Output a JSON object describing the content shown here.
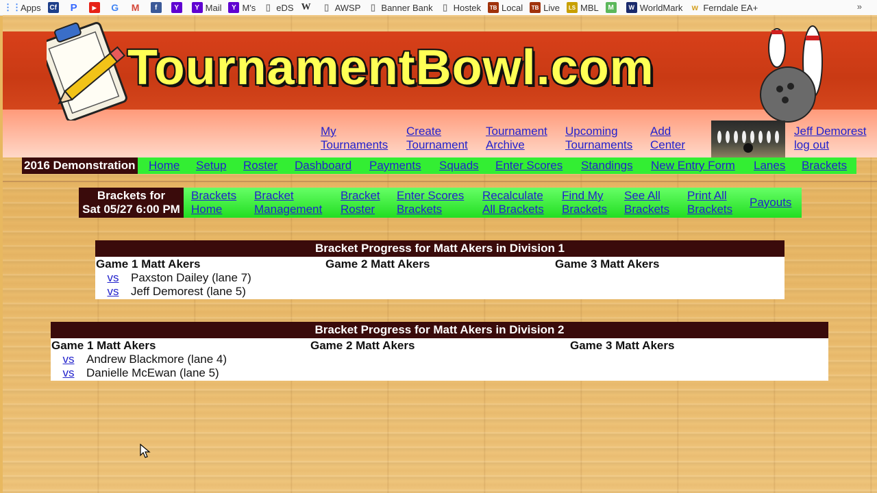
{
  "bookmarks": [
    {
      "label": "Apps",
      "icon": "apps-grid-icon",
      "color": "#4285f4"
    },
    {
      "label": "",
      "icon": "cf-icon",
      "color": "#1e3f8a",
      "glyph": "Cf"
    },
    {
      "label": "",
      "icon": "pandora-icon",
      "color": "#3668ff",
      "glyph": "P"
    },
    {
      "label": "",
      "icon": "youtube-icon",
      "color": "#e62117",
      "glyph": "▶"
    },
    {
      "label": "",
      "icon": "google-icon",
      "color": "#4285f4",
      "glyph": "G"
    },
    {
      "label": "",
      "icon": "gmail-icon",
      "color": "#d44638",
      "glyph": "M"
    },
    {
      "label": "",
      "icon": "facebook-icon",
      "color": "#3b5998",
      "glyph": "f"
    },
    {
      "label": "",
      "icon": "yahoo-icon",
      "color": "#5f01d1",
      "glyph": "Y"
    },
    {
      "label": "Mail",
      "icon": "yahoo-mail-icon",
      "color": "#5f01d1",
      "glyph": "Y"
    },
    {
      "label": "M's",
      "icon": "yahoo-ms-icon",
      "color": "#5f01d1",
      "glyph": "Y"
    },
    {
      "label": "eDS",
      "icon": "page-icon",
      "color": "#888888",
      "glyph": "▯"
    },
    {
      "label": "",
      "icon": "wikipedia-icon",
      "color": "#333333",
      "glyph": "W"
    },
    {
      "label": "AWSP",
      "icon": "page-icon",
      "color": "#888888",
      "glyph": "▯"
    },
    {
      "label": "Banner Bank",
      "icon": "page-icon",
      "color": "#888888",
      "glyph": "▯"
    },
    {
      "label": "Hostek",
      "icon": "page-icon",
      "color": "#888888",
      "glyph": "▯"
    },
    {
      "label": "Local",
      "icon": "tb-icon",
      "color": "#a0320c",
      "glyph": "TB"
    },
    {
      "label": "Live",
      "icon": "tb-icon",
      "color": "#a0320c",
      "glyph": "TB"
    },
    {
      "label": "MBL",
      "icon": "ls-icon",
      "color": "#c8a000",
      "glyph": "LS"
    },
    {
      "label": "",
      "icon": "m-green-icon",
      "color": "#5cb85c",
      "glyph": "M"
    },
    {
      "label": "WorldMark",
      "icon": "worldmark-icon",
      "color": "#1a2a6c",
      "glyph": "W"
    },
    {
      "label": "Ferndale EA+",
      "icon": "ferndale-icon",
      "color": "#d4a020",
      "glyph": "W"
    }
  ],
  "bookmarks_more": "»",
  "logo_text": "TournamentBowl.com",
  "top_nav": [
    {
      "line1": "My",
      "line2": "Tournaments"
    },
    {
      "line1": "Create",
      "line2": "Tournament"
    },
    {
      "line1": "Tournament",
      "line2": "Archive"
    },
    {
      "line1": "Upcoming",
      "line2": "Tournaments"
    },
    {
      "line1": "Add",
      "line2": "Center"
    }
  ],
  "user": {
    "name": "Jeff Demorest",
    "logout": "log out"
  },
  "tournament_label": "2016 Demonstration",
  "main_nav": [
    "Home",
    "Setup",
    "Roster",
    "Dashboard",
    "Payments",
    "Squads",
    "Enter Scores",
    "Standings",
    "New Entry Form",
    "Lanes",
    "Brackets"
  ],
  "brackets_for": {
    "line1": "Brackets for",
    "line2": "Sat 05/27 6:00 PM"
  },
  "sub_nav": [
    {
      "line1": "Brackets",
      "line2": "Home"
    },
    {
      "line1": "Bracket",
      "line2": "Management"
    },
    {
      "line1": "Bracket",
      "line2": "Roster"
    },
    {
      "line1": "Enter Scores",
      "line2": "Brackets"
    },
    {
      "line1": "Recalculate",
      "line2": "All Brackets"
    },
    {
      "line1": "Find My",
      "line2": "Brackets"
    },
    {
      "line1": "See All",
      "line2": "Brackets"
    },
    {
      "line1": "Print All",
      "line2": "Brackets"
    },
    {
      "line1": "Payouts",
      "line2": ""
    }
  ],
  "panels": [
    {
      "title": "Bracket Progress for Matt Akers in Division 1",
      "games": [
        "Game 1 Matt Akers",
        "Game 2 Matt Akers",
        "Game 3 Matt Akers"
      ],
      "matches": [
        {
          "vs": "vs",
          "opponent": "Paxston Dailey (lane 7)"
        },
        {
          "vs": "vs",
          "opponent": "Jeff Demorest (lane 5)"
        }
      ]
    },
    {
      "title": "Bracket Progress for Matt Akers in Division 2",
      "games": [
        "Game 1 Matt Akers",
        "Game 2 Matt Akers",
        "Game 3 Matt Akers"
      ],
      "matches": [
        {
          "vs": "vs",
          "opponent": "Andrew Blackmore (lane 4)"
        },
        {
          "vs": "vs",
          "opponent": "Danielle McEwan (lane 5)"
        }
      ]
    }
  ]
}
